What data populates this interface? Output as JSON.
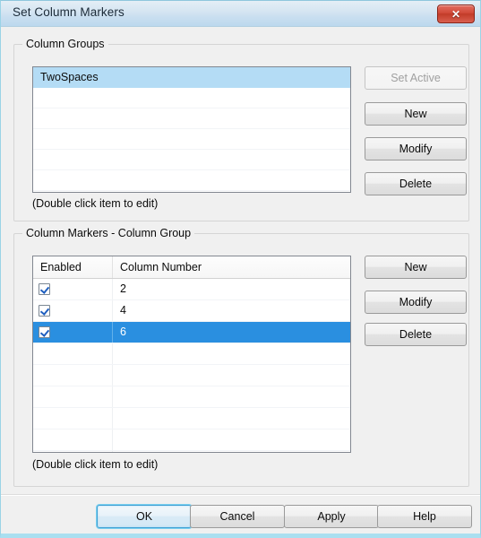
{
  "window": {
    "title": "Set Column Markers",
    "close_icon": "close-icon",
    "close_glyph": "✕",
    "accent_selection": "#2a8fe0",
    "accent_listbox_selection": "#b4dcf5",
    "titlebar_color": "#cadff0"
  },
  "column_groups": {
    "legend": "Column Groups",
    "items": [
      {
        "label": "TwoSpaces",
        "selected": true
      }
    ],
    "hint": "(Double click item to edit)",
    "buttons": [
      {
        "label": "Set Active",
        "enabled": false
      },
      {
        "label": "New",
        "enabled": true
      },
      {
        "label": "Modify",
        "enabled": true
      },
      {
        "label": "Delete",
        "enabled": true
      }
    ]
  },
  "column_markers": {
    "legend": "Column Markers - Column Group",
    "columns": [
      "Enabled",
      "Column Number"
    ],
    "rows": [
      {
        "enabled": true,
        "column_number": "2",
        "selected": false
      },
      {
        "enabled": true,
        "column_number": "4",
        "selected": false
      },
      {
        "enabled": true,
        "column_number": "6",
        "selected": true
      }
    ],
    "hint": "(Double click item to edit)",
    "buttons": [
      {
        "label": "New",
        "enabled": true
      },
      {
        "label": "Modify",
        "enabled": true
      },
      {
        "label": "Delete",
        "enabled": true
      }
    ]
  },
  "footer": {
    "ok": "OK",
    "cancel": "Cancel",
    "apply": "Apply",
    "help": "Help"
  }
}
